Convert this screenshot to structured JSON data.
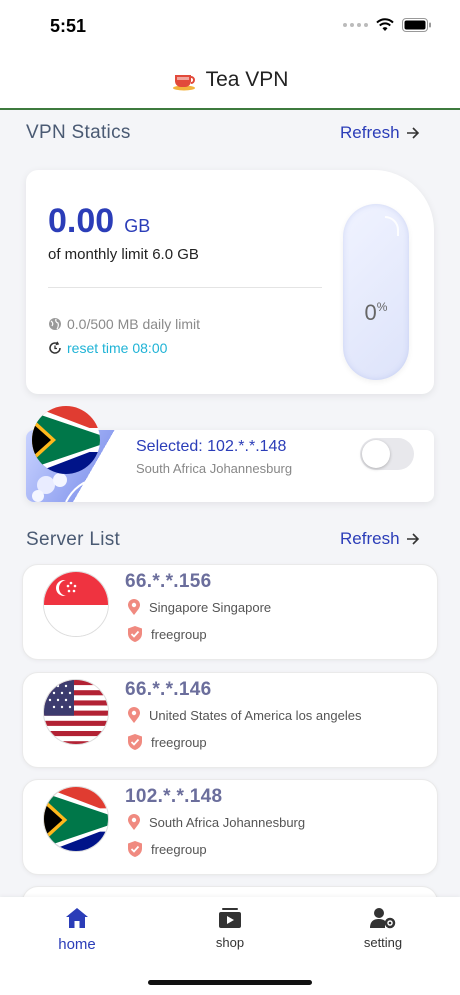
{
  "status_bar": {
    "time": "5:51"
  },
  "app": {
    "title": "Tea VPN"
  },
  "stats": {
    "section_title": "VPN Statics",
    "refresh_label": "Refresh",
    "used_value": "0.00",
    "used_unit": "GB",
    "monthly_limit_text": "of monthly limit 6.0 GB",
    "daily_limit_text": "0.0/500 MB daily limit",
    "reset_text": "reset time 08:00",
    "gauge_percent_value": "0",
    "gauge_percent_sign": "%",
    "gauge_fill_fraction": 0
  },
  "selected": {
    "ip": "Selected: 102.*.*.148",
    "location": "South Africa Johannesburg",
    "flag": "south-africa",
    "connected": false
  },
  "server_list": {
    "section_title": "Server List",
    "refresh_label": "Refresh",
    "servers": [
      {
        "ip": "66.*.*.156",
        "location": "Singapore Singapore",
        "group": "freegroup",
        "flag": "singapore"
      },
      {
        "ip": "66.*.*.146",
        "location": "United States of America los angeles",
        "group": "freegroup",
        "flag": "usa"
      },
      {
        "ip": "102.*.*.148",
        "location": "South Africa Johannesburg",
        "group": "freegroup",
        "flag": "south-africa"
      }
    ]
  },
  "tabs": [
    {
      "label": "home",
      "icon": "home-icon",
      "active": true
    },
    {
      "label": "shop",
      "icon": "shop-icon",
      "active": false
    },
    {
      "label": "setting",
      "icon": "setting-icon",
      "active": false
    }
  ],
  "colors": {
    "accent": "#2b3db8",
    "cyan": "#1fb3d6",
    "header_line": "#3d7a3d",
    "location_pin": "#f08a80"
  }
}
